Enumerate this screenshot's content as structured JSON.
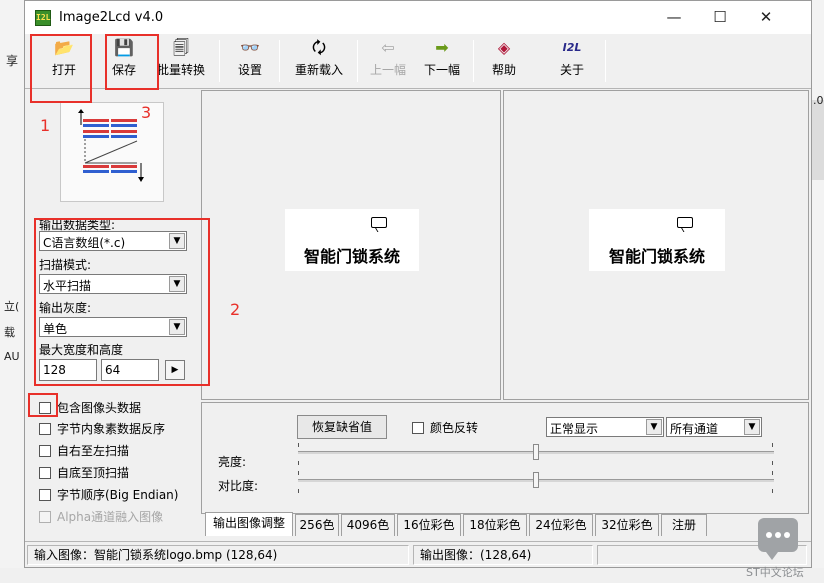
{
  "window": {
    "title": "Image2Lcd v4.0",
    "app_icon_text": "I2L",
    "controls": [
      "—",
      "☐",
      "✕"
    ]
  },
  "background": {
    "left_fragments": [
      "享",
      "立(",
      "载",
      "AU"
    ],
    "right_fragment": ".0"
  },
  "toolbar": [
    {
      "label": "打开",
      "icon": "open-icon",
      "glyph": "📂",
      "enabled": true
    },
    {
      "label": "保存",
      "icon": "save-icon",
      "glyph": "💾",
      "enabled": true
    },
    {
      "label": "批量转换",
      "icon": "batch-convert-icon",
      "glyph": "🗐",
      "enabled": true
    },
    {
      "label": "设置",
      "icon": "settings-glasses-icon",
      "glyph": "👓",
      "enabled": true
    },
    {
      "label": "重新载入",
      "icon": "reload-icon",
      "glyph": "🗘",
      "enabled": true
    },
    {
      "label": "上一幅",
      "icon": "previous-icon",
      "glyph": "⇦",
      "enabled": false
    },
    {
      "label": "下一幅",
      "icon": "next-icon",
      "glyph": "➡",
      "enabled": true
    },
    {
      "label": "帮助",
      "icon": "help-icon",
      "glyph": "◈",
      "enabled": true
    },
    {
      "label": "关于",
      "icon": "about-icon",
      "glyph": "I2L",
      "enabled": true
    }
  ],
  "left_panel": {
    "output_type_label": "输出数据类型:",
    "output_type_value": "C语言数组(*.c)",
    "scan_mode_label": "扫描模式:",
    "scan_mode_value": "水平扫描",
    "gray_label": "输出灰度:",
    "gray_value": "单色",
    "size_label": "最大宽度和高度",
    "max_width": "128",
    "max_height": "64",
    "arrow": "▶",
    "checkboxes": [
      {
        "label": "包含图像头数据",
        "checked": false,
        "enabled": true
      },
      {
        "label": "字节内象素数据反序",
        "checked": false,
        "enabled": true
      },
      {
        "label": "自右至左扫描",
        "checked": false,
        "enabled": true
      },
      {
        "label": "自底至顶扫描",
        "checked": false,
        "enabled": true
      },
      {
        "label": "字节顺序(Big Endian)",
        "checked": false,
        "enabled": true
      },
      {
        "label": "Alpha通道融入图像",
        "checked": false,
        "enabled": false
      }
    ]
  },
  "previews": {
    "input_logo_text": "智能门锁系统",
    "output_logo_text": "智能门锁系统"
  },
  "settings": {
    "restore_button": "恢复缺省值",
    "invert_label": "颜色反转",
    "display_mode": "正常显示",
    "channel": "所有通道",
    "brightness_label": "亮度:",
    "contrast_label": "对比度:",
    "brightness_value": 0.5,
    "contrast_value": 0.5
  },
  "tabs": [
    "输出图像调整",
    "256色",
    "4096色",
    "16位彩色",
    "18位彩色",
    "24位彩色",
    "32位彩色",
    "注册"
  ],
  "status": {
    "input": "输入图像：智能门锁系统logo.bmp (128,64)",
    "output": "输出图像：(128,64)"
  },
  "annotations": [
    "1",
    "2",
    "3"
  ],
  "watermark": {
    "text": "ST中文论坛"
  },
  "colors": {
    "annotation": "#e8302a",
    "window_bg": "#f0f0f0",
    "scan_red": "#d93a3a",
    "scan_blue": "#2f5fd0"
  }
}
